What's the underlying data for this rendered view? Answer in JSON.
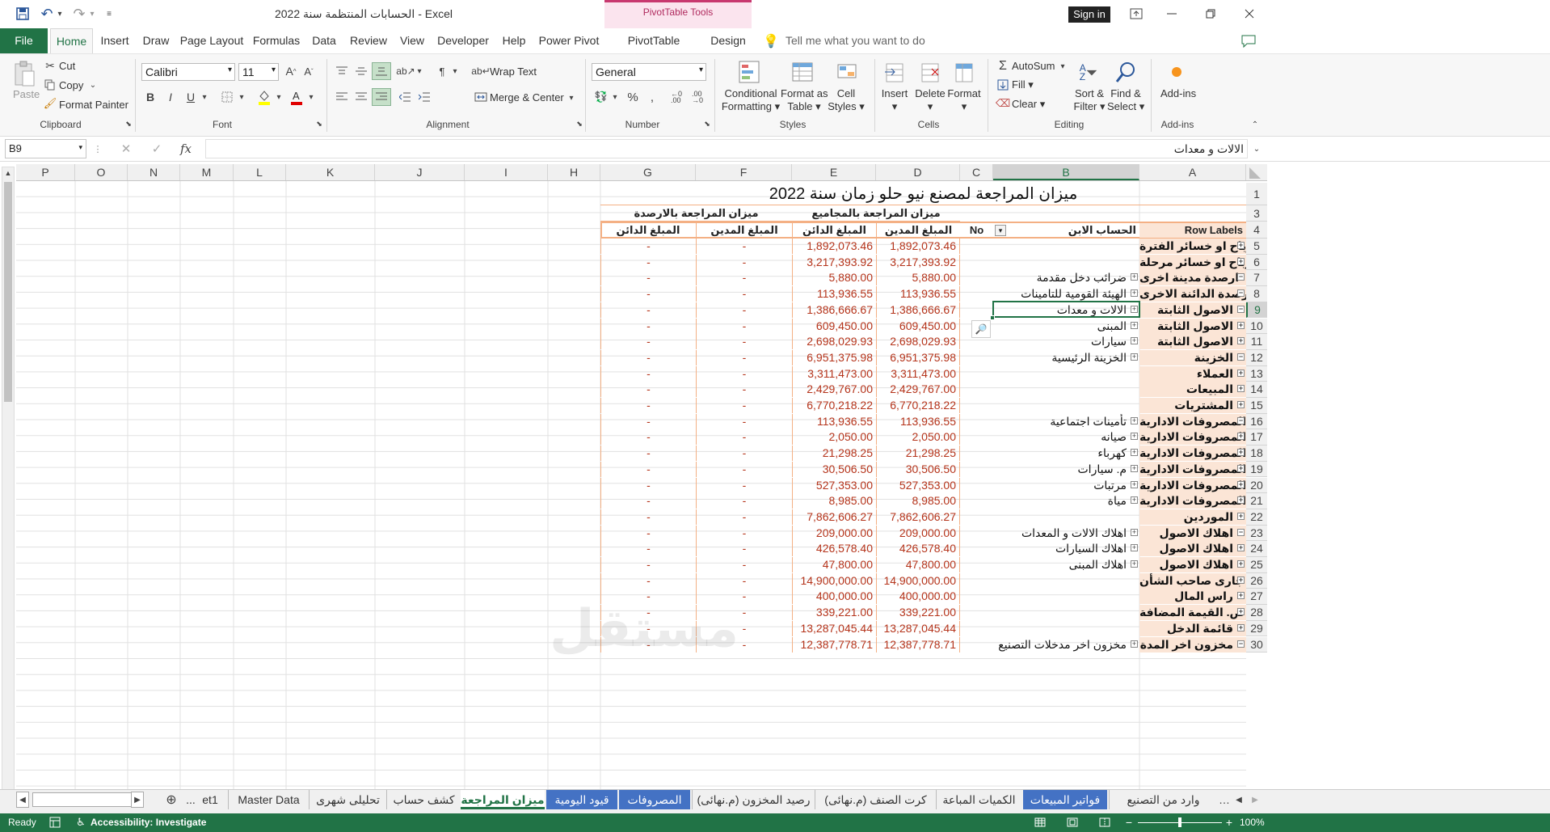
{
  "app": {
    "title": "الحسابات المنتظمة سنة 2022  -  Excel",
    "context_tools": "PivotTable Tools",
    "sign_in": "Sign in"
  },
  "tabs": [
    "File",
    "Home",
    "Insert",
    "Draw",
    "Page Layout",
    "Formulas",
    "Data",
    "Review",
    "View",
    "Developer",
    "Help",
    "Power Pivot",
    "PivotTable Analyze",
    "Design"
  ],
  "tell_me": "Tell me what you want to do",
  "ribbon": {
    "clipboard": {
      "paste": "Paste",
      "cut": "Cut",
      "copy": "Copy",
      "format_painter": "Format Painter",
      "label": "Clipboard"
    },
    "font": {
      "name": "Calibri",
      "size": "11",
      "label": "Font"
    },
    "alignment": {
      "wrap": "Wrap Text",
      "merge": "Merge & Center",
      "label": "Alignment"
    },
    "number": {
      "format": "General",
      "label": "Number"
    },
    "styles": {
      "conditional_1": "Conditional",
      "conditional_2": "Formatting",
      "format_table_1": "Format as",
      "format_table_2": "Table",
      "cell_styles_1": "Cell",
      "cell_styles_2": "Styles",
      "label": "Styles"
    },
    "cells": {
      "insert": "Insert",
      "delete": "Delete",
      "format": "Format",
      "label": "Cells"
    },
    "editing": {
      "autosum": "AutoSum",
      "fill": "Fill",
      "clear": "Clear",
      "sort_1": "Sort &",
      "sort_2": "Filter",
      "find_1": "Find &",
      "find_2": "Select",
      "label": "Editing"
    },
    "addins": {
      "button": "Add-ins",
      "label": "Add-ins"
    }
  },
  "formula_bar": {
    "name_box": "B9",
    "content": "الالات و معدات"
  },
  "columns": {
    "A": "A",
    "B": "B",
    "C": "C",
    "D": "D",
    "E": "E",
    "F": "F",
    "G": "G",
    "H": "H",
    "I": "I",
    "J": "J",
    "K": "K",
    "L": "L",
    "M": "M",
    "N": "N",
    "O": "O",
    "P": "P"
  },
  "sheet": {
    "title": "ميزان المراجعة لمصنع نيو حلو زمان سنة 2022",
    "group_totals": "ميزان المراجعة بالمجاميع",
    "group_balances": "ميزان المراجعة بالارصدة",
    "headers": {
      "row_labels": "Row Labels",
      "child_account": "الحساب الابن",
      "no": "No",
      "debit": "المبلغ المدين",
      "credit": "المبلغ الدائن",
      "bal_debit": "المبلغ المدين",
      "bal_credit": "المبلغ الدائن"
    },
    "dash": "-",
    "rows": [
      {
        "n": "5",
        "a": "ارباح او خسائر الفترة",
        "b": "",
        "e": "+",
        "d": "1,892,073.46",
        "c": "1,892,073.46"
      },
      {
        "n": "6",
        "a": "ارباح او خسائر مرحلة",
        "b": "",
        "e": "+",
        "d": "3,217,393.92",
        "c": "3,217,393.92"
      },
      {
        "n": "7",
        "a": "ارصدة مدينة اخرى",
        "b": "ضرائب دخل مقدمة",
        "e": "-",
        "d": "5,880.00",
        "c": "5,880.00"
      },
      {
        "n": "8",
        "a": "الارصدة الدائنة الاخرى",
        "b": "الهيئة القومية للتامينات",
        "e": "-",
        "d": "113,936.55",
        "c": "113,936.55"
      },
      {
        "n": "9",
        "a": "الاصول الثابتة",
        "b": "الالات و معدات",
        "e": "-",
        "d": "1,386,666.67",
        "c": "1,386,666.67"
      },
      {
        "n": "10",
        "a": "الاصول الثابتة",
        "b": "المبنى",
        "e": "",
        "d": "609,450.00",
        "c": "609,450.00"
      },
      {
        "n": "11",
        "a": "الاصول الثابتة",
        "b": "سيارات",
        "e": "",
        "d": "2,698,029.93",
        "c": "2,698,029.93"
      },
      {
        "n": "12",
        "a": "الخزينة",
        "b": "الخزينة الرئيسية",
        "e": "-",
        "d": "6,951,375.98",
        "c": "6,951,375.98"
      },
      {
        "n": "13",
        "a": "العملاء",
        "b": "",
        "e": "+",
        "d": "3,311,473.00",
        "c": "3,311,473.00"
      },
      {
        "n": "14",
        "a": "المبيعات",
        "b": "",
        "e": "+",
        "d": "2,429,767.00",
        "c": "2,429,767.00"
      },
      {
        "n": "15",
        "a": "المشتريات",
        "b": "",
        "e": "+",
        "d": "6,770,218.22",
        "c": "6,770,218.22"
      },
      {
        "n": "16",
        "a": "المصروفات الادارية",
        "b": "تأمينات اجتماعية",
        "e": "-",
        "d": "113,936.55",
        "c": "113,936.55"
      },
      {
        "n": "17",
        "a": "المصروفات الادارية",
        "b": "صيانه",
        "e": "",
        "d": "2,050.00",
        "c": "2,050.00"
      },
      {
        "n": "18",
        "a": "المصروفات الادارية",
        "b": "كهرباء",
        "e": "",
        "d": "21,298.25",
        "c": "21,298.25"
      },
      {
        "n": "19",
        "a": "المصروفات الادارية",
        "b": "م. سيارات",
        "e": "",
        "d": "30,506.50",
        "c": "30,506.50"
      },
      {
        "n": "20",
        "a": "المصروفات الادارية",
        "b": "مرتبات",
        "e": "",
        "d": "527,353.00",
        "c": "527,353.00"
      },
      {
        "n": "21",
        "a": "المصروفات الادارية",
        "b": "مياة",
        "e": "",
        "d": "8,985.00",
        "c": "8,985.00"
      },
      {
        "n": "22",
        "a": "الموردين",
        "b": "",
        "e": "+",
        "d": "7,862,606.27",
        "c": "7,862,606.27"
      },
      {
        "n": "23",
        "a": "اهلاك الاصول",
        "b": "اهلاك الالات و المعدات",
        "e": "-",
        "d": "209,000.00",
        "c": "209,000.00"
      },
      {
        "n": "24",
        "a": "اهلاك الاصول",
        "b": "اهلاك السيارات",
        "e": "",
        "d": "426,578.40",
        "c": "426,578.40"
      },
      {
        "n": "25",
        "a": "اهلاك الاصول",
        "b": "اهلاك المبنى",
        "e": "",
        "d": "47,800.00",
        "c": "47,800.00"
      },
      {
        "n": "26",
        "a": "جارى صاحب الشأن",
        "b": "",
        "e": "+",
        "d": "14,900,000.00",
        "c": "14,900,000.00"
      },
      {
        "n": "27",
        "a": "راس المال",
        "b": "",
        "e": "+",
        "d": "400,000.00",
        "c": "400,000.00"
      },
      {
        "n": "28",
        "a": "ض. القيمة المضافة",
        "b": "",
        "e": "+",
        "d": "339,221.00",
        "c": "339,221.00"
      },
      {
        "n": "29",
        "a": "قائمة الدخل",
        "b": "",
        "e": "+",
        "d": "13,287,045.44",
        "c": "13,287,045.44"
      },
      {
        "n": "30",
        "a": "مخزون اخر المدة",
        "b": "مخزون اخر مدخلات التصنيع",
        "e": "-",
        "d": "12,387,778.71",
        "c": "12,387,778.71"
      }
    ],
    "row_numbers": [
      "1",
      "2",
      "3",
      "4"
    ]
  },
  "sheet_tabs": [
    "وارد من التصنيع",
    "فواتير المبيعات",
    "الكميات المباعة",
    "كرت الصنف (م.نهائى)",
    "رصيد المخزون (م.نهائى)",
    "المصروفات",
    "قيود اليومية",
    "ميزان المراجعة",
    "كشف حساب",
    "تحليلى شهرى",
    "Master Data",
    "et1",
    "..."
  ],
  "status": {
    "ready": "Ready",
    "accessibility": "Accessibility: Investigate",
    "zoom": "100%"
  },
  "watermark": "مستقل",
  "colors": {
    "excel_green": "#217346",
    "pivot_header": "#fbe5d6",
    "border_orange": "#f4b084",
    "number_red": "#b5341b",
    "pivot_tools": "#c8386f"
  }
}
